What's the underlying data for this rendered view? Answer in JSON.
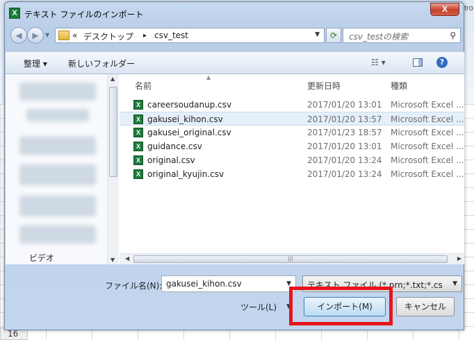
{
  "background": {
    "row_number": "16",
    "edge_text": "tro"
  },
  "dialog": {
    "title": "テキスト ファイルのインポート",
    "app_icon_glyph": "X",
    "close_glyph": "X"
  },
  "address": {
    "prefix": "«",
    "part1": "デスクトップ",
    "separator": "▸",
    "part2": "csv_test",
    "search_placeholder": "csv_testの検索"
  },
  "toolbar": {
    "organize": "整理 ▾",
    "new_folder": "新しいフォルダー",
    "view_glyph": "☷ ▾",
    "help_glyph": "?"
  },
  "nav_pane": {
    "video_label": "ビデオ"
  },
  "columns": {
    "name": "名前",
    "date": "更新日時",
    "type": "種類"
  },
  "files": [
    {
      "name": "careersoudanup.csv",
      "date": "2017/01/20 13:01",
      "type": "Microsoft Excel ..."
    },
    {
      "name": "gakusei_kihon.csv",
      "date": "2017/01/20 13:57",
      "type": "Microsoft Excel ...",
      "selected": true
    },
    {
      "name": "gakusei_original.csv",
      "date": "2017/01/23 18:57",
      "type": "Microsoft Excel ..."
    },
    {
      "name": "guidance.csv",
      "date": "2017/01/20 13:01",
      "type": "Microsoft Excel ..."
    },
    {
      "name": "original.csv",
      "date": "2017/01/20 13:24",
      "type": "Microsoft Excel ..."
    },
    {
      "name": "original_kyujin.csv",
      "date": "2017/01/20 13:24",
      "type": "Microsoft Excel ..."
    }
  ],
  "bottom": {
    "filename_label": "ファイル名(N):",
    "filename_value": "gakusei_kihon.csv",
    "filetype_value": "テキスト ファイル (*.prn;*.txt;*.cs",
    "tools": "ツール(L)",
    "import": "インポート(M)",
    "cancel": "キャンセル"
  },
  "colors": {
    "highlight": "#e8141c",
    "selected_row": "#e5eff9",
    "excel_green": "#1f7a3d"
  }
}
